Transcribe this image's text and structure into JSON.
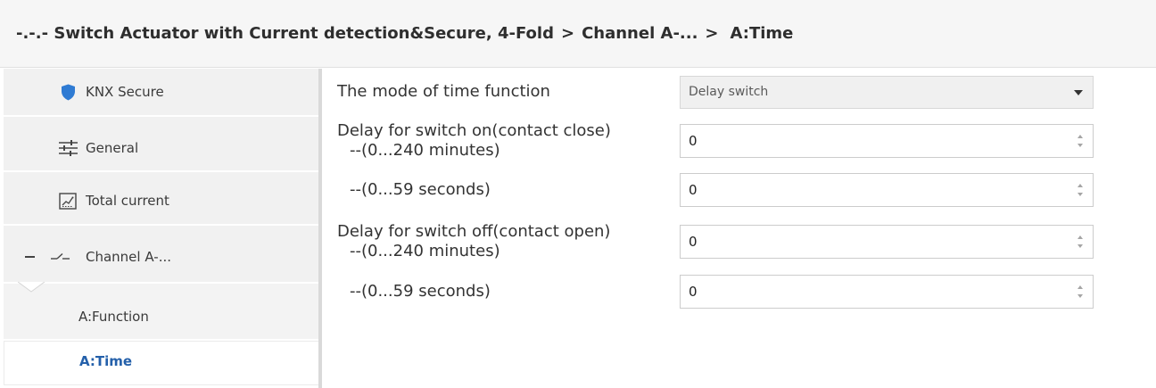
{
  "breadcrumb": {
    "items": [
      "-.-.- Switch Actuator with Current detection&Secure, 4-Fold",
      "Channel A-...",
      "A:Time"
    ],
    "separator": ">"
  },
  "sidebar": {
    "items": [
      {
        "label": "KNX Secure",
        "icon": "shield-icon"
      },
      {
        "label": "General",
        "icon": "sliders-icon"
      },
      {
        "label": "Total current",
        "icon": "chart-icon"
      },
      {
        "label": "Channel A-...",
        "icon": "switch-icon",
        "expanded": true
      }
    ],
    "subitems": [
      {
        "label": "A:Function",
        "selected": false
      },
      {
        "label": "A:Time",
        "selected": true
      }
    ]
  },
  "params": [
    {
      "label": "The mode of time function",
      "value": "Delay switch"
    },
    {
      "label": "Delay for switch on(contact close)",
      "sublabel": "--(0...240 minutes)",
      "value": "0"
    },
    {
      "sublabel": "--(0...59 seconds)",
      "value": "0"
    },
    {
      "label": "Delay for switch off(contact open)",
      "sublabel": "--(0...240 minutes)",
      "value": "0"
    },
    {
      "sublabel": "--(0...59 seconds)",
      "value": "0"
    }
  ],
  "colors": {
    "selected_text": "#2460aa",
    "shield": "#2f7bd3"
  }
}
